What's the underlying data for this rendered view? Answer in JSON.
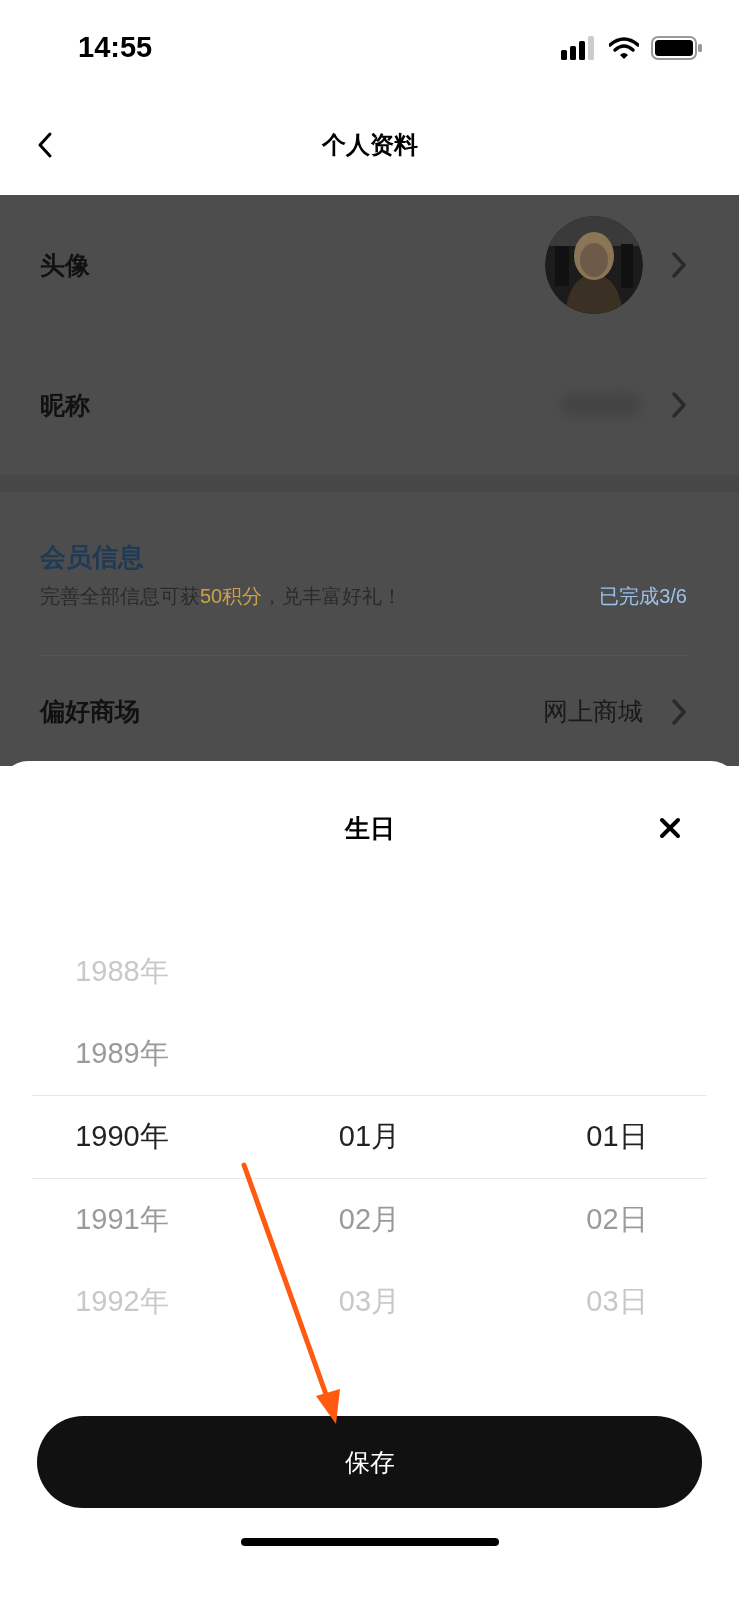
{
  "status_bar": {
    "time": "14:55"
  },
  "nav": {
    "title": "个人资料"
  },
  "profile_rows": [
    {
      "kind": "avatar",
      "label": "头像"
    },
    {
      "kind": "blurred",
      "label": "昵称"
    }
  ],
  "member_info": {
    "title": "会员信息",
    "subtitle": "完善全部信息可获**50积分**，兑丰富好礼！",
    "progress": "已完成3/6"
  },
  "preference_rows": [
    {
      "kind": "value",
      "label": "偏好商场",
      "value": "网上商城"
    }
  ],
  "birthday_sheet": {
    "title": "生日",
    "rows": [
      {
        "year": "1988年",
        "selected": false
      },
      {
        "year": "1989年",
        "selected": false
      },
      {
        "year": "1990年",
        "month": "01月",
        "day": "01日",
        "selected": true
      },
      {
        "year": "1991年",
        "month": "02月",
        "day": "02日",
        "selected": false
      },
      {
        "year": "1992年",
        "month": "03月",
        "day": "03日",
        "selected": false
      }
    ],
    "save_button": "保存"
  },
  "annotation": {
    "kind": "arrow"
  }
}
